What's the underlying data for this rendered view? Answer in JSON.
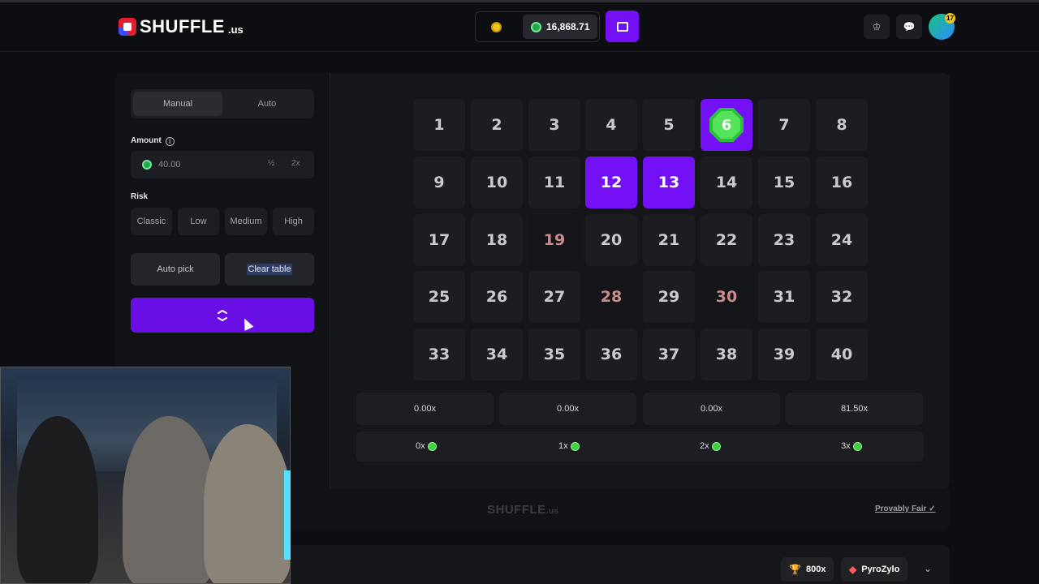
{
  "brand": {
    "name": "SHUFFLE",
    "suffix": ".us"
  },
  "header": {
    "balance": "16,868.71",
    "avatar_badge": "17",
    "icons": [
      "token-coin-icon",
      "wallet-icon",
      "crown-icon",
      "chat-icon",
      "avatar"
    ]
  },
  "sidebar": {
    "tabs": [
      {
        "label": "Manual",
        "active": true
      },
      {
        "label": "Auto",
        "active": false
      }
    ],
    "amount_label": "Amount",
    "amount_value": "40.00",
    "half_label": "½",
    "double_label": "2x",
    "risk_label": "Risk",
    "risk_options": [
      "Classic",
      "Low",
      "Medium",
      "High"
    ],
    "auto_pick_label": "Auto pick",
    "clear_table_label": "Clear table"
  },
  "board": {
    "tiles": [
      "1",
      "2",
      "3",
      "4",
      "5",
      "6",
      "7",
      "8",
      "9",
      "10",
      "11",
      "12",
      "13",
      "14",
      "15",
      "16",
      "17",
      "18",
      "19",
      "20",
      "21",
      "22",
      "23",
      "24",
      "25",
      "26",
      "27",
      "28",
      "29",
      "30",
      "31",
      "32",
      "33",
      "34",
      "35",
      "36",
      "37",
      "38",
      "39",
      "40"
    ],
    "selected": [
      "12",
      "13"
    ],
    "gem_hit": "6",
    "dimmed": [
      "19",
      "28",
      "30"
    ]
  },
  "multipliers": [
    "0.00x",
    "0.00x",
    "0.00x",
    "81.50x"
  ],
  "hits": [
    "0x",
    "1x",
    "2x",
    "3x"
  ],
  "footer": {
    "logo": "SHUFFLE",
    "logo_suffix": ".us",
    "provably_fair": "Provably Fair"
  },
  "bottom": {
    "wager": "800x",
    "user": "PyroZylo"
  },
  "colors": {
    "accent": "#7410f5",
    "gem": "#2bbf3a",
    "background": "#0d0e11",
    "panel": "#15161a"
  }
}
